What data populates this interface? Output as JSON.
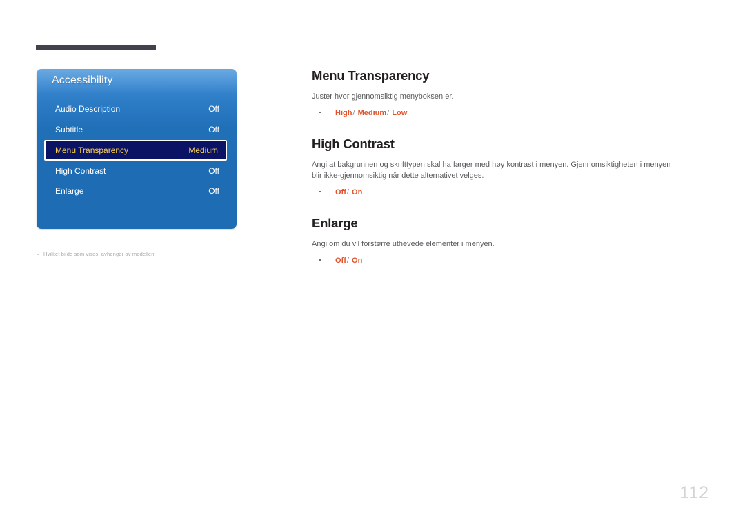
{
  "page": {
    "number": "112"
  },
  "header": {
    "accent_bar_color": "#45404e",
    "rule_color": "#9b9ba3"
  },
  "figure": {
    "osd": {
      "title": "Accessibility",
      "panel_color_top": "#4b97da",
      "panel_color_bottom": "#1e6cb4",
      "highlight_bg": "#0b1464",
      "highlight_text_color": "#ffd24d",
      "rows": [
        {
          "label": "Audio Description",
          "value": "Off",
          "selected": false
        },
        {
          "label": "Subtitle",
          "value": "Off",
          "selected": false
        },
        {
          "label": "Menu Transparency",
          "value": "Medium",
          "selected": true
        },
        {
          "label": "High Contrast",
          "value": "Off",
          "selected": false
        },
        {
          "label": "Enlarge",
          "value": "Off",
          "selected": false
        }
      ]
    },
    "note": {
      "dash": "–",
      "text": "Hvilket bilde som vises, avhenger av modellen."
    }
  },
  "content": {
    "sections": [
      {
        "heading": "Menu Transparency",
        "body": "Juster hvor gjennomsiktig menyboksen er.",
        "options": [
          {
            "value": "High",
            "sep": "/"
          },
          {
            "value": "Medium",
            "sep": "/"
          },
          {
            "value": "Low",
            "sep": ""
          }
        ]
      },
      {
        "heading": "High Contrast",
        "body": "Angi at bakgrunnen og skrifttypen skal ha farger med høy kontrast i menyen. Gjennomsiktigheten i menyen blir ikke-gjennomsiktig når dette alternativet velges.",
        "options": [
          {
            "value": "Off",
            "sep": "/"
          },
          {
            "value": "On",
            "sep": ""
          }
        ]
      },
      {
        "heading": "Enlarge",
        "body": "Angi om du vil forstørre uthevede elementer i menyen.",
        "options": [
          {
            "value": "Off",
            "sep": "/"
          },
          {
            "value": "On",
            "sep": ""
          }
        ]
      }
    ],
    "option_color": "#e2512a"
  }
}
